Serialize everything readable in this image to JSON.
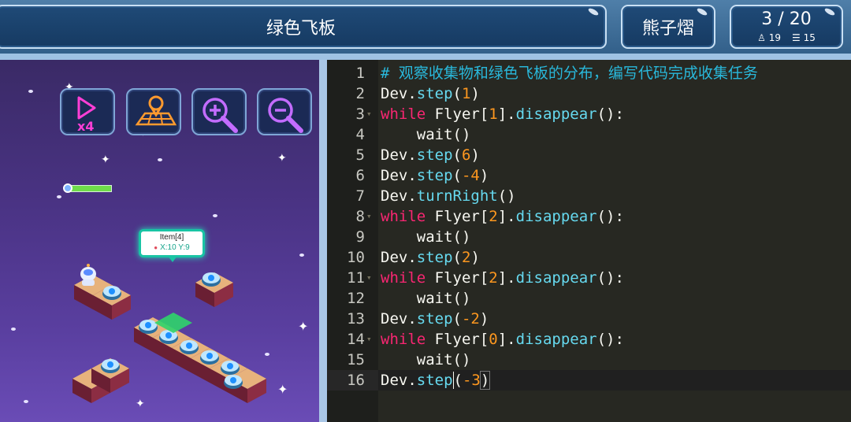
{
  "header": {
    "title": "绿色飞板",
    "user": "熊子熠",
    "level": {
      "progress": "3 / 20",
      "stat_a": "19",
      "stat_b": "15"
    }
  },
  "toolbar": {
    "speed_icon": "play-x4-icon",
    "map_icon": "map-pin-icon",
    "zoom_in_icon": "zoom-in-icon",
    "zoom_out_icon": "zoom-out-icon",
    "speed_label": "x4"
  },
  "game": {
    "health_fraction": 1.0,
    "tooltip": {
      "name": "Item[4]",
      "coords": "X:10 Y:9"
    }
  },
  "editor": {
    "lines": [
      {
        "n": "1",
        "fold": "",
        "tokens": [
          {
            "t": "# 观察收集物和绿色飞板的分布，编写代码完成收集任务",
            "c": "c-comment"
          }
        ]
      },
      {
        "n": "2",
        "fold": "",
        "tokens": [
          {
            "t": "Dev.",
            "c": ""
          },
          {
            "t": "step",
            "c": "c-fn"
          },
          {
            "t": "(",
            "c": ""
          },
          {
            "t": "1",
            "c": "c-num"
          },
          {
            "t": ")",
            "c": ""
          }
        ]
      },
      {
        "n": "3",
        "fold": "▾",
        "tokens": [
          {
            "t": "while",
            "c": "c-kw"
          },
          {
            "t": " Flyer[",
            "c": ""
          },
          {
            "t": "1",
            "c": "c-num"
          },
          {
            "t": "].",
            "c": ""
          },
          {
            "t": "disappear",
            "c": "c-fn"
          },
          {
            "t": "():",
            "c": ""
          }
        ]
      },
      {
        "n": "4",
        "fold": "",
        "tokens": [
          {
            "t": "    wait()",
            "c": ""
          }
        ]
      },
      {
        "n": "5",
        "fold": "",
        "tokens": [
          {
            "t": "Dev.",
            "c": ""
          },
          {
            "t": "step",
            "c": "c-fn"
          },
          {
            "t": "(",
            "c": ""
          },
          {
            "t": "6",
            "c": "c-num"
          },
          {
            "t": ")",
            "c": ""
          }
        ]
      },
      {
        "n": "6",
        "fold": "",
        "tokens": [
          {
            "t": "Dev.",
            "c": ""
          },
          {
            "t": "step",
            "c": "c-fn"
          },
          {
            "t": "(",
            "c": ""
          },
          {
            "t": "-4",
            "c": "c-num"
          },
          {
            "t": ")",
            "c": ""
          }
        ]
      },
      {
        "n": "7",
        "fold": "",
        "tokens": [
          {
            "t": "Dev.",
            "c": ""
          },
          {
            "t": "turnRight",
            "c": "c-fn"
          },
          {
            "t": "()",
            "c": ""
          }
        ]
      },
      {
        "n": "8",
        "fold": "▾",
        "tokens": [
          {
            "t": "while",
            "c": "c-kw"
          },
          {
            "t": " Flyer[",
            "c": ""
          },
          {
            "t": "2",
            "c": "c-num"
          },
          {
            "t": "].",
            "c": ""
          },
          {
            "t": "disappear",
            "c": "c-fn"
          },
          {
            "t": "():",
            "c": ""
          }
        ]
      },
      {
        "n": "9",
        "fold": "",
        "tokens": [
          {
            "t": "    wait()",
            "c": ""
          }
        ]
      },
      {
        "n": "10",
        "fold": "",
        "tokens": [
          {
            "t": "Dev.",
            "c": ""
          },
          {
            "t": "step",
            "c": "c-fn"
          },
          {
            "t": "(",
            "c": ""
          },
          {
            "t": "2",
            "c": "c-num"
          },
          {
            "t": ")",
            "c": ""
          }
        ]
      },
      {
        "n": "11",
        "fold": "▾",
        "tokens": [
          {
            "t": "while",
            "c": "c-kw"
          },
          {
            "t": " Flyer[",
            "c": ""
          },
          {
            "t": "2",
            "c": "c-num"
          },
          {
            "t": "].",
            "c": ""
          },
          {
            "t": "disappear",
            "c": "c-fn"
          },
          {
            "t": "():",
            "c": ""
          }
        ]
      },
      {
        "n": "12",
        "fold": "",
        "tokens": [
          {
            "t": "    wait()",
            "c": ""
          }
        ]
      },
      {
        "n": "13",
        "fold": "",
        "tokens": [
          {
            "t": "Dev.",
            "c": ""
          },
          {
            "t": "step",
            "c": "c-fn"
          },
          {
            "t": "(",
            "c": ""
          },
          {
            "t": "-2",
            "c": "c-num"
          },
          {
            "t": ")",
            "c": ""
          }
        ]
      },
      {
        "n": "14",
        "fold": "▾",
        "tokens": [
          {
            "t": "while",
            "c": "c-kw"
          },
          {
            "t": " Flyer[",
            "c": ""
          },
          {
            "t": "0",
            "c": "c-num"
          },
          {
            "t": "].",
            "c": ""
          },
          {
            "t": "disappear",
            "c": "c-fn"
          },
          {
            "t": "():",
            "c": ""
          }
        ]
      },
      {
        "n": "15",
        "fold": "",
        "tokens": [
          {
            "t": "    wait()",
            "c": ""
          }
        ]
      },
      {
        "n": "16",
        "fold": "",
        "tokens": [
          {
            "t": "Dev.",
            "c": ""
          },
          {
            "t": "step",
            "c": "c-fn"
          },
          {
            "t": "(",
            "c": "c-cursor"
          },
          {
            "t": "-3",
            "c": "c-num"
          },
          {
            "t": ")",
            "c": "c-bracket"
          }
        ]
      }
    ],
    "active_line": "16"
  }
}
